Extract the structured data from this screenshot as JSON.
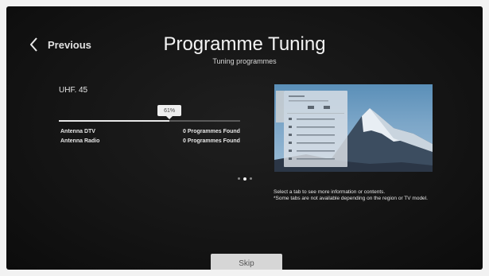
{
  "nav": {
    "back_label": "Previous"
  },
  "header": {
    "title": "Programme Tuning",
    "subtitle": "Tuning programmes"
  },
  "tuning": {
    "channel": "UHF. 45",
    "progress_percent": 61,
    "progress_label": "61%",
    "results": [
      {
        "label": "Antenna DTV",
        "value": "0 Programmes Found"
      },
      {
        "label": "Antenna Radio",
        "value": "0 Programmes Found"
      }
    ]
  },
  "preview": {
    "page_count": 3,
    "active_page": 1,
    "info_lines": [
      "Select a tab to see more information or contents.",
      "*Some tabs are not available depending on the region or TV model."
    ]
  },
  "footer": {
    "skip_label": "Skip"
  },
  "colors": {
    "background": "#141414",
    "text": "#e8e8e8",
    "button": "#d6d6d6"
  }
}
